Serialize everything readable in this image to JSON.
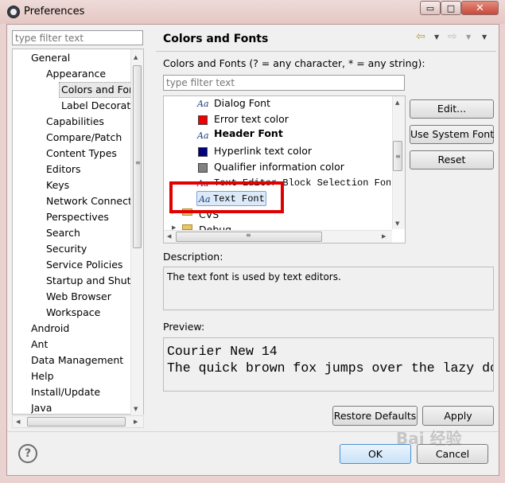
{
  "window": {
    "title": "Preferences",
    "minimize": "▭",
    "maximize": "□",
    "close": "✕"
  },
  "left": {
    "filter_placeholder": "type filter text",
    "tree": [
      {
        "label": "General"
      },
      {
        "label": "Appearance"
      },
      {
        "label": "Colors and Fonts"
      },
      {
        "label": "Label Decorations"
      },
      {
        "label": "Capabilities"
      },
      {
        "label": "Compare/Patch"
      },
      {
        "label": "Content Types"
      },
      {
        "label": "Editors"
      },
      {
        "label": "Keys"
      },
      {
        "label": "Network Connections"
      },
      {
        "label": "Perspectives"
      },
      {
        "label": "Search"
      },
      {
        "label": "Security"
      },
      {
        "label": "Service Policies"
      },
      {
        "label": "Startup and Shutdown"
      },
      {
        "label": "Web Browser"
      },
      {
        "label": "Workspace"
      },
      {
        "label": "Android"
      },
      {
        "label": "Ant"
      },
      {
        "label": "Data Management"
      },
      {
        "label": "Help"
      },
      {
        "label": "Install/Update"
      },
      {
        "label": "Java"
      }
    ]
  },
  "page": {
    "title": "Colors and Fonts",
    "filter_caption": "Colors and Fonts (? = any character, * = any string):",
    "filter_placeholder": "type filter text",
    "tree": [
      {
        "icon": "font-icon",
        "label": "Dialog Font"
      },
      {
        "icon": "color-swatch-icon",
        "color": "#ee0000",
        "label": "Error text color"
      },
      {
        "icon": "font-icon",
        "label": "Header Font"
      },
      {
        "icon": "color-swatch-icon",
        "color": "#000080",
        "label": "Hyperlink text color"
      },
      {
        "icon": "color-swatch-icon",
        "color": "#808080",
        "label": "Qualifier information color"
      },
      {
        "icon": "font-icon",
        "label": "Text Editor Block Selection Font"
      },
      {
        "icon": "font-icon",
        "label": "Text Font"
      },
      {
        "icon": "folder-icon",
        "label": "CVS"
      },
      {
        "icon": "folder-icon",
        "label": "Debug"
      }
    ],
    "icon_glyph": "Aa",
    "buttons": {
      "edit": "Edit...",
      "use_system_font": "Use System Font",
      "reset": "Reset"
    },
    "description_label": "Description:",
    "description_text": "The text font is used by text editors.",
    "preview_label": "Preview:",
    "preview_lines": [
      "Courier New 14",
      "The quick brown fox jumps over the lazy dog."
    ],
    "restore_defaults": "Restore Defaults",
    "apply": "Apply"
  },
  "footer": {
    "help": "?",
    "ok": "OK",
    "cancel": "Cancel"
  },
  "watermark": "Bai 经验",
  "icons": {
    "back": "⇦",
    "forward": "⇨",
    "dropdown": "▼",
    "menu": "▾",
    "up_arrow": "▲",
    "down_arrow": "▼",
    "left_arrow": "◀",
    "right_arrow": "▶",
    "grip": "≡"
  },
  "colors": {
    "highlight_red": "#e00000",
    "selection_bg": "#dbe9f9"
  }
}
